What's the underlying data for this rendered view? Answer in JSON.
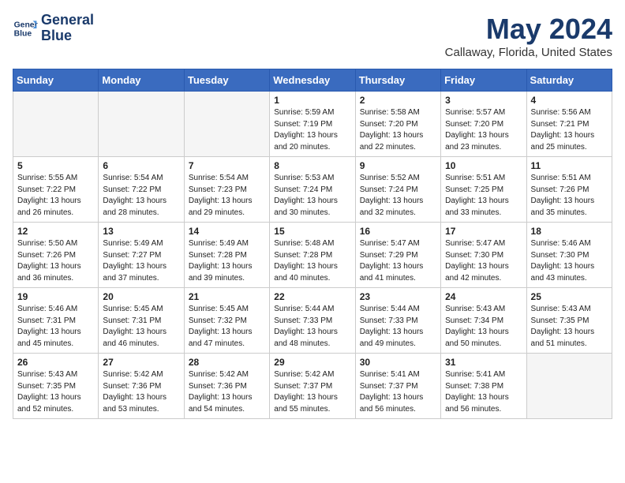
{
  "header": {
    "logo_line1": "General",
    "logo_line2": "Blue",
    "month_title": "May 2024",
    "location": "Callaway, Florida, United States"
  },
  "weekdays": [
    "Sunday",
    "Monday",
    "Tuesday",
    "Wednesday",
    "Thursday",
    "Friday",
    "Saturday"
  ],
  "weeks": [
    [
      {
        "day": "",
        "info": ""
      },
      {
        "day": "",
        "info": ""
      },
      {
        "day": "",
        "info": ""
      },
      {
        "day": "1",
        "info": "Sunrise: 5:59 AM\nSunset: 7:19 PM\nDaylight: 13 hours\nand 20 minutes."
      },
      {
        "day": "2",
        "info": "Sunrise: 5:58 AM\nSunset: 7:20 PM\nDaylight: 13 hours\nand 22 minutes."
      },
      {
        "day": "3",
        "info": "Sunrise: 5:57 AM\nSunset: 7:20 PM\nDaylight: 13 hours\nand 23 minutes."
      },
      {
        "day": "4",
        "info": "Sunrise: 5:56 AM\nSunset: 7:21 PM\nDaylight: 13 hours\nand 25 minutes."
      }
    ],
    [
      {
        "day": "5",
        "info": "Sunrise: 5:55 AM\nSunset: 7:22 PM\nDaylight: 13 hours\nand 26 minutes."
      },
      {
        "day": "6",
        "info": "Sunrise: 5:54 AM\nSunset: 7:22 PM\nDaylight: 13 hours\nand 28 minutes."
      },
      {
        "day": "7",
        "info": "Sunrise: 5:54 AM\nSunset: 7:23 PM\nDaylight: 13 hours\nand 29 minutes."
      },
      {
        "day": "8",
        "info": "Sunrise: 5:53 AM\nSunset: 7:24 PM\nDaylight: 13 hours\nand 30 minutes."
      },
      {
        "day": "9",
        "info": "Sunrise: 5:52 AM\nSunset: 7:24 PM\nDaylight: 13 hours\nand 32 minutes."
      },
      {
        "day": "10",
        "info": "Sunrise: 5:51 AM\nSunset: 7:25 PM\nDaylight: 13 hours\nand 33 minutes."
      },
      {
        "day": "11",
        "info": "Sunrise: 5:51 AM\nSunset: 7:26 PM\nDaylight: 13 hours\nand 35 minutes."
      }
    ],
    [
      {
        "day": "12",
        "info": "Sunrise: 5:50 AM\nSunset: 7:26 PM\nDaylight: 13 hours\nand 36 minutes."
      },
      {
        "day": "13",
        "info": "Sunrise: 5:49 AM\nSunset: 7:27 PM\nDaylight: 13 hours\nand 37 minutes."
      },
      {
        "day": "14",
        "info": "Sunrise: 5:49 AM\nSunset: 7:28 PM\nDaylight: 13 hours\nand 39 minutes."
      },
      {
        "day": "15",
        "info": "Sunrise: 5:48 AM\nSunset: 7:28 PM\nDaylight: 13 hours\nand 40 minutes."
      },
      {
        "day": "16",
        "info": "Sunrise: 5:47 AM\nSunset: 7:29 PM\nDaylight: 13 hours\nand 41 minutes."
      },
      {
        "day": "17",
        "info": "Sunrise: 5:47 AM\nSunset: 7:30 PM\nDaylight: 13 hours\nand 42 minutes."
      },
      {
        "day": "18",
        "info": "Sunrise: 5:46 AM\nSunset: 7:30 PM\nDaylight: 13 hours\nand 43 minutes."
      }
    ],
    [
      {
        "day": "19",
        "info": "Sunrise: 5:46 AM\nSunset: 7:31 PM\nDaylight: 13 hours\nand 45 minutes."
      },
      {
        "day": "20",
        "info": "Sunrise: 5:45 AM\nSunset: 7:31 PM\nDaylight: 13 hours\nand 46 minutes."
      },
      {
        "day": "21",
        "info": "Sunrise: 5:45 AM\nSunset: 7:32 PM\nDaylight: 13 hours\nand 47 minutes."
      },
      {
        "day": "22",
        "info": "Sunrise: 5:44 AM\nSunset: 7:33 PM\nDaylight: 13 hours\nand 48 minutes."
      },
      {
        "day": "23",
        "info": "Sunrise: 5:44 AM\nSunset: 7:33 PM\nDaylight: 13 hours\nand 49 minutes."
      },
      {
        "day": "24",
        "info": "Sunrise: 5:43 AM\nSunset: 7:34 PM\nDaylight: 13 hours\nand 50 minutes."
      },
      {
        "day": "25",
        "info": "Sunrise: 5:43 AM\nSunset: 7:35 PM\nDaylight: 13 hours\nand 51 minutes."
      }
    ],
    [
      {
        "day": "26",
        "info": "Sunrise: 5:43 AM\nSunset: 7:35 PM\nDaylight: 13 hours\nand 52 minutes."
      },
      {
        "day": "27",
        "info": "Sunrise: 5:42 AM\nSunset: 7:36 PM\nDaylight: 13 hours\nand 53 minutes."
      },
      {
        "day": "28",
        "info": "Sunrise: 5:42 AM\nSunset: 7:36 PM\nDaylight: 13 hours\nand 54 minutes."
      },
      {
        "day": "29",
        "info": "Sunrise: 5:42 AM\nSunset: 7:37 PM\nDaylight: 13 hours\nand 55 minutes."
      },
      {
        "day": "30",
        "info": "Sunrise: 5:41 AM\nSunset: 7:37 PM\nDaylight: 13 hours\nand 56 minutes."
      },
      {
        "day": "31",
        "info": "Sunrise: 5:41 AM\nSunset: 7:38 PM\nDaylight: 13 hours\nand 56 minutes."
      },
      {
        "day": "",
        "info": ""
      }
    ]
  ]
}
